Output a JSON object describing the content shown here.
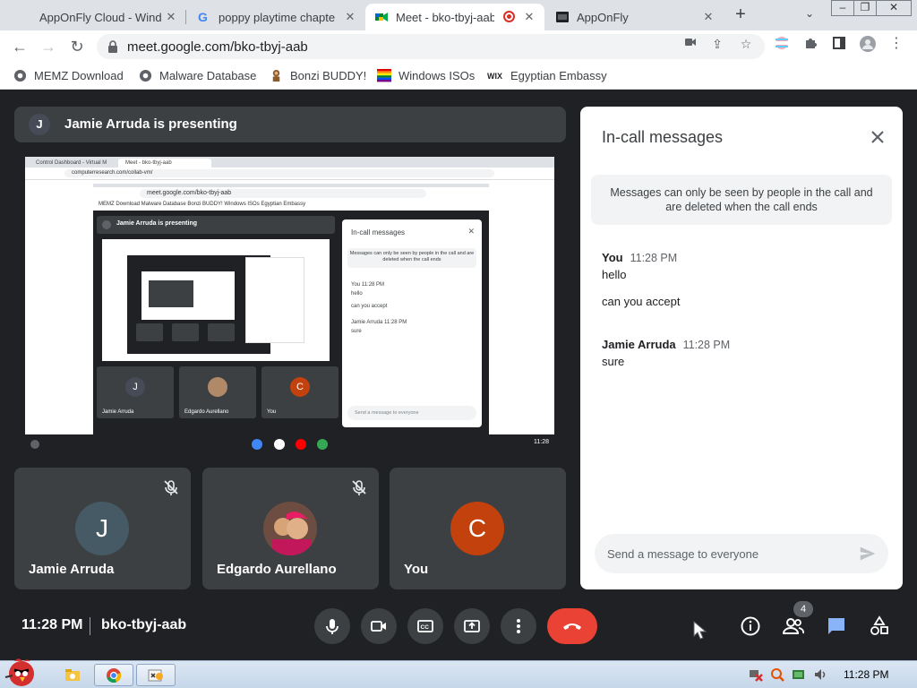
{
  "browser": {
    "tabs": [
      {
        "title": "AppOnFly Cloud - Wind",
        "active": false
      },
      {
        "title": "poppy playtime chapte",
        "active": false
      },
      {
        "title": "Meet - bko-tbyj-aab",
        "active": true
      },
      {
        "title": "AppOnFly",
        "active": false
      }
    ],
    "new_tab": "+",
    "url": "meet.google.com/bko-tbyj-aab",
    "bookmarks": [
      "MEMZ Download",
      "Malware Database",
      "Bonzi BUDDY!",
      "Windows ISOs",
      "Egyptian Embassy"
    ]
  },
  "meet": {
    "presenter_initial": "J",
    "presenting_label": "Jamie Arruda is presenting",
    "participants": [
      {
        "name": "Jamie Arruda",
        "initial": "J",
        "color": "#455a64",
        "muted": true
      },
      {
        "name": "Edgardo Aurellano",
        "initial": "",
        "color": "#8d6e63",
        "muted": true
      },
      {
        "name": "You",
        "initial": "C",
        "color": "#c2410c",
        "muted": false
      }
    ],
    "time": "11:28 PM",
    "meeting_code": "bko-tbyj-aab",
    "people_count": "4",
    "end_call_color": "#ea4335"
  },
  "share": {
    "tab1": "Control Dashboard - Virtual M",
    "tab2": "Meet - bko-tbyj-aab",
    "url": "computerresearch.com/collab-vm/",
    "inner_url": "meet.google.com/bko-tbyj-aab",
    "inner_bookmarks": "MEMZ Download   Malware Database   Bonzi BUDDY!   Windows ISOs   Egyptian Embassy",
    "inner_presenting": "Jamie Arruda is presenting",
    "inner_chat_title": "In-call messages",
    "inner_chat_note": "Messages can only be seen by people in the call and are deleted when the call ends",
    "inner_msgs": [
      "You   11:28 PM",
      "hello",
      "can you accept",
      "Jamie Arruda   11:28 PM",
      "sure"
    ],
    "inner_send": "Send a message to everyone",
    "inner_tiles": [
      "Jamie Arruda",
      "Edgardo Aurellano",
      "You"
    ],
    "inner_tile_initials": [
      "J",
      "",
      "C"
    ],
    "clock": "11:28"
  },
  "chat": {
    "title": "In-call messages",
    "note": "Messages can only be seen by people in the call and are deleted when the call ends",
    "messages": [
      {
        "sender": "You",
        "time": "11:28 PM",
        "texts": [
          "hello",
          "can you accept"
        ]
      },
      {
        "sender": "Jamie Arruda",
        "time": "11:28 PM",
        "texts": [
          "sure"
        ]
      }
    ],
    "input_placeholder": "Send a message to everyone"
  },
  "taskbar": {
    "clock": "11:28 PM"
  }
}
